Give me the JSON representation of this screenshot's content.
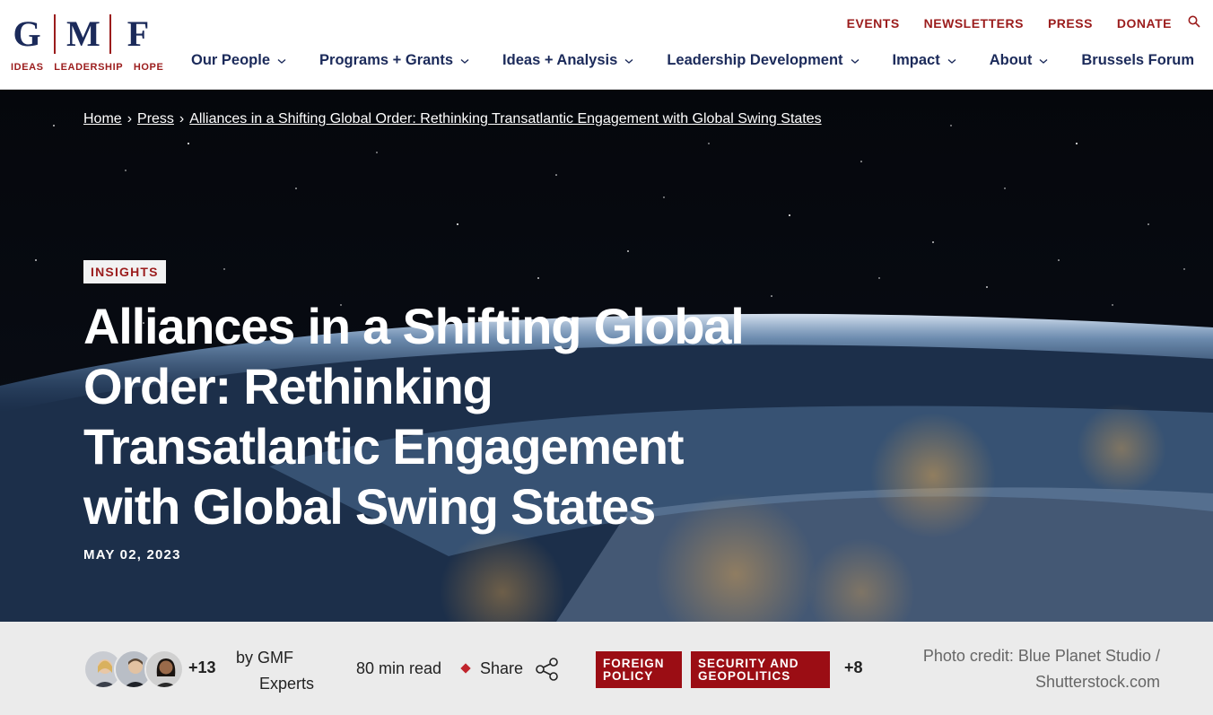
{
  "logo": {
    "letters": [
      "G",
      "M",
      "F"
    ],
    "tagline": [
      "IDEAS",
      "LEADERSHIP",
      "HOPE"
    ]
  },
  "utility_nav": [
    "EVENTS",
    "NEWSLETTERS",
    "PRESS",
    "DONATE"
  ],
  "main_nav": [
    {
      "label": "Our People",
      "dropdown": true
    },
    {
      "label": "Programs + Grants",
      "dropdown": true
    },
    {
      "label": "Ideas + Analysis",
      "dropdown": true
    },
    {
      "label": "Leadership Development",
      "dropdown": true
    },
    {
      "label": "Impact",
      "dropdown": true
    },
    {
      "label": "About",
      "dropdown": true
    },
    {
      "label": "Brussels Forum",
      "dropdown": false
    }
  ],
  "breadcrumb": [
    "Home",
    "Press",
    "Alliances in a Shifting Global Order: Rethinking Transatlantic Engagement with Global Swing States"
  ],
  "hero": {
    "badge": "INSIGHTS",
    "title": "Alliances in a Shifting Global Order: Rethinking Transatlantic Engagement with Global Swing States",
    "date": "MAY 02, 2023"
  },
  "meta": {
    "extra_authors": "+13",
    "byline_prefix": "by GMF",
    "byline_suffix": "Experts",
    "read_time": "80 min read",
    "share_label": "Share",
    "tags": [
      "FOREIGN POLICY",
      "SECURITY AND GEOPOLITICS"
    ],
    "extra_tags": "+8",
    "photo_credit_line1": "Photo credit: Blue Planet Studio /",
    "photo_credit_line2": "Shutterstock.com"
  },
  "colors": {
    "brand_navy": "#1b2a5a",
    "brand_red": "#9b1c1c",
    "tag_red": "#9b0d14",
    "meta_bg": "#ebebeb"
  }
}
